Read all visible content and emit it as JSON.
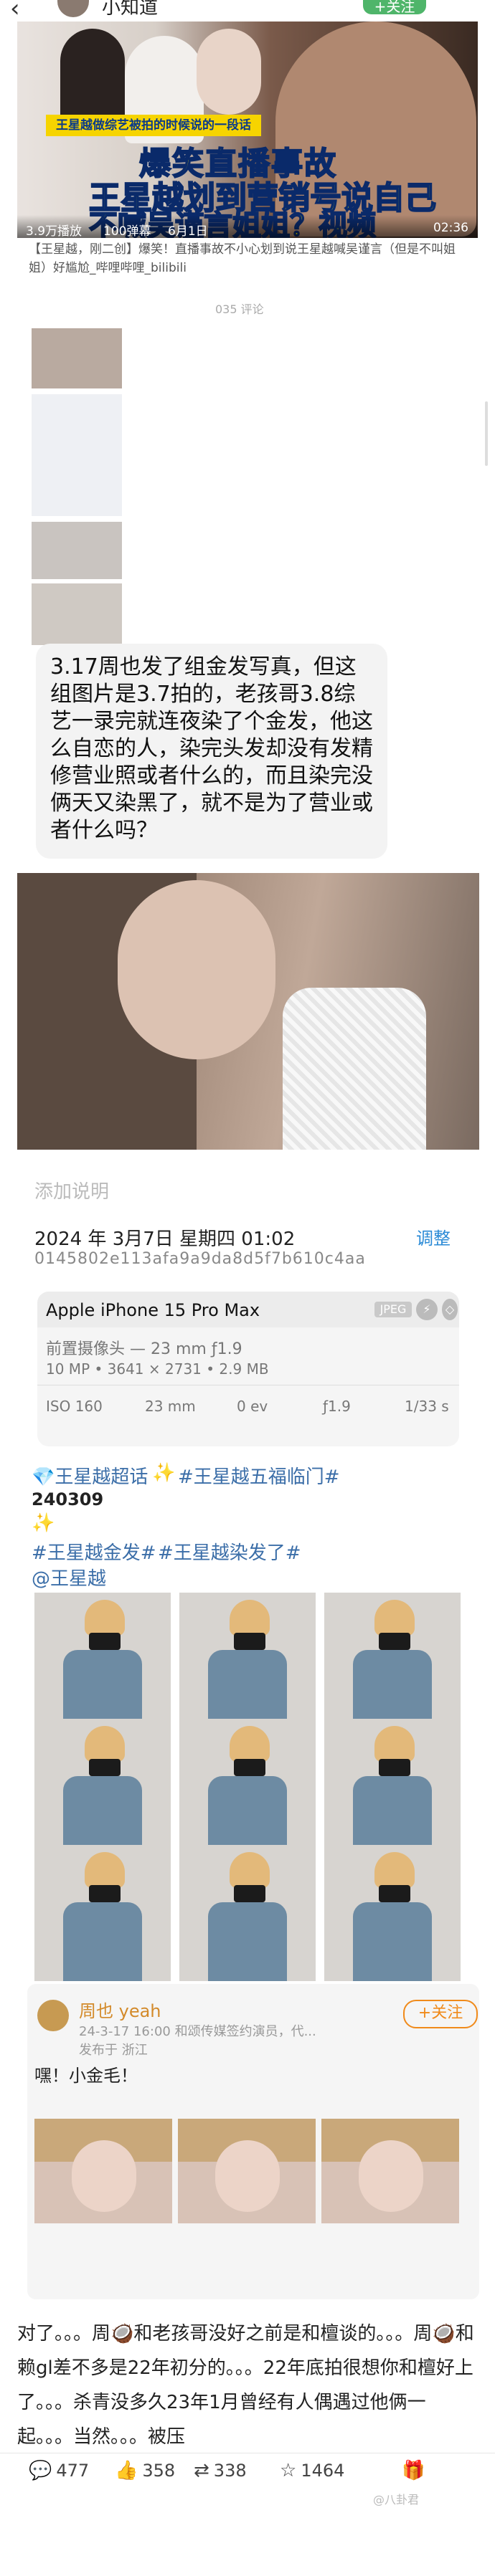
{
  "top_bar": {
    "back_icon": "chevron-left-icon",
    "name": "小知道",
    "follow": "+关注"
  },
  "video": {
    "banner": "王星越做综艺被拍的时候说的一段话",
    "title1": "爆笑直播事故",
    "title2": "王星越划到营销号说自己",
    "title3": "不喊吴谨言姐姐？视频",
    "plays": "3.9万播放",
    "likes": "100弹幕",
    "date": "6月1日",
    "duration": "02:36",
    "caption": "【王星越，刚二创】爆笑！直播事故不小心划到说王星越喊吴谨言（但是不叫姐姐）好尴尬_哔哩哔哩_bilibili"
  },
  "comments_dots": "035 评论",
  "bubble_text": "3.17周也发了组金发写真，但这组图片是3.7拍的，老孩哥3.8综艺一录完就连夜染了个金发，他这么自恋的人，染完头发却没有发精修营业照或者什么的，而且染完没俩天又染黑了，就不是为了营业或者什么吗？",
  "photo_note": "添加说明",
  "exif": {
    "date": "2024 年 3月7日 星期四 01:02",
    "adjust": "调整",
    "hash": "0145802e113afa9a9da8d5f7b610c4aa",
    "model": "Apple iPhone 15 Pro Max",
    "format": "JPEG",
    "lens": "前置摄像头 — 23 mm ƒ1.9",
    "specs": "10 MP • 3641 × 2731 • 2.9 MB",
    "iso": "ISO 160",
    "focal": "23 mm",
    "ev": "0 ev",
    "aperture": "ƒ1.9",
    "shutter": "1/33 s"
  },
  "weibo": {
    "tag1": "💎王星越超话",
    "spark1": "✨",
    "tag2": "#王星越五福临门#",
    "number": "240309",
    "spark2": "✨",
    "tag3": "#王星越金发#",
    "tag4": "#王星越染发了#",
    "mention": "@王星越"
  },
  "repost": {
    "name": "周也 yeah",
    "sub": "24-3-17 16:00  和颂传媒签约演员，代...",
    "location": "发布于 浙江",
    "follow": "+关注",
    "text": "嘿！小金毛！"
  },
  "bottom_text": "对了。。。周🥥和老孩哥没好之前是和檀谈的。。。周🥥和赖gl差不多是22年初分的。。。22年底拍很想你和檀好上了。。。杀青没多久23年1月曾经有人偶遇过他俩一起。。。当然。。。被压",
  "actions": {
    "comments": "477",
    "likes": "358",
    "reposts": "338",
    "favorites": "1464"
  },
  "watermark": "@八卦君"
}
